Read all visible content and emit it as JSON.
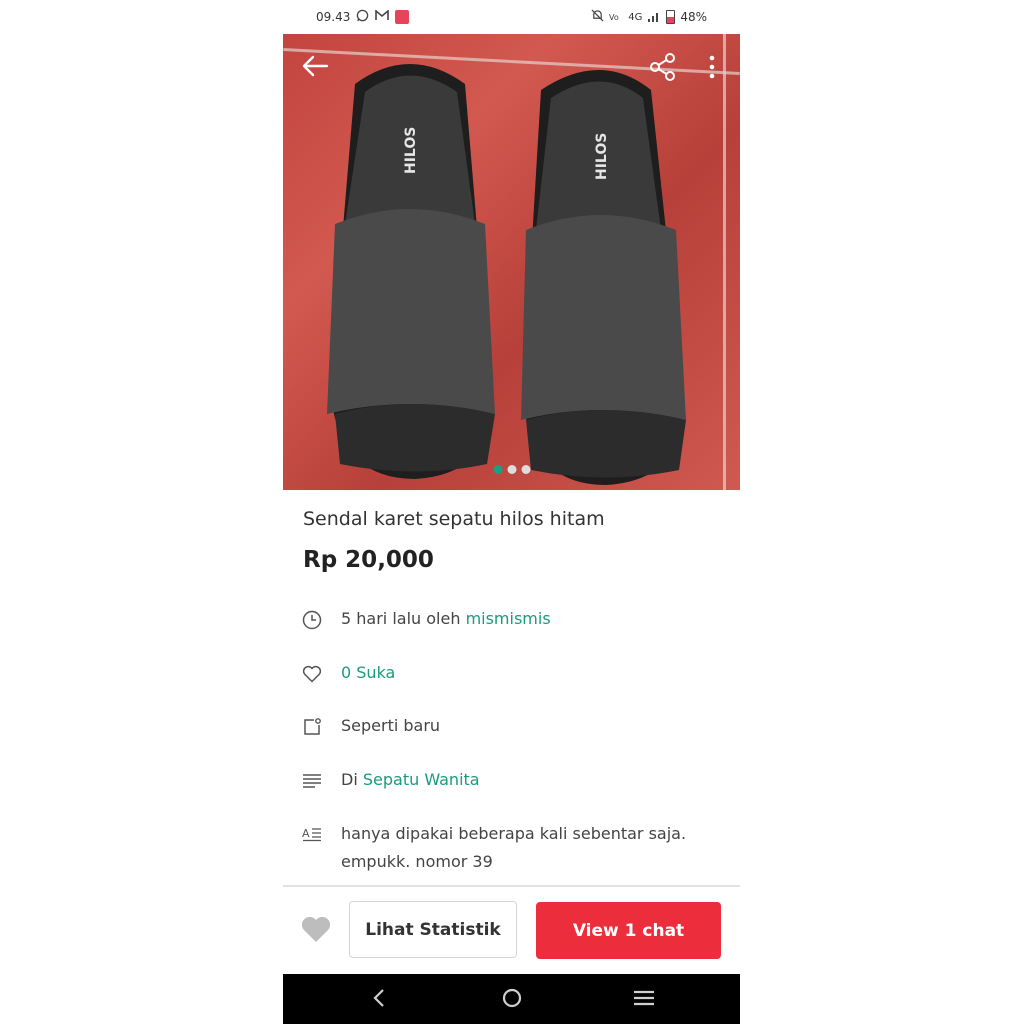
{
  "status_bar": {
    "time": "09.43",
    "network": "4G",
    "battery": "48%"
  },
  "product": {
    "title": "Sendal karet sepatu hilos hitam",
    "price": "Rp 20,000",
    "photo_brand_text": "HILOS",
    "image_count": 3,
    "active_image": 1
  },
  "details": {
    "time_prefix": "5 hari lalu oleh",
    "seller": "mismismis",
    "likes": "0 Suka",
    "condition": "Seperti baru",
    "category_prefix": "Di",
    "category": "Sepatu Wanita",
    "description_line1": "hanya dipakai beberapa kali sebentar saja.",
    "description_line2": "empukk. nomor 39"
  },
  "actions": {
    "stats_button": "Lihat Statistik",
    "chat_button": "View 1 chat"
  },
  "colors": {
    "accent_teal": "#1a9a7f",
    "chat_red": "#ec2d3c"
  }
}
